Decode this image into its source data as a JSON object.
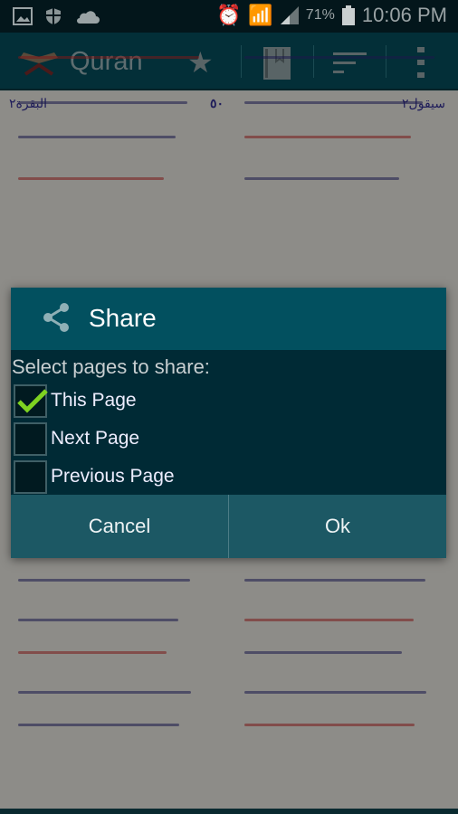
{
  "status_bar": {
    "battery": "71%",
    "time": "10:06 PM",
    "icons": [
      "image-icon",
      "shield-icon",
      "cloud-icon",
      "alarm-icon",
      "wifi-icon",
      "signal-icon",
      "battery-icon"
    ]
  },
  "app_bar": {
    "title": "Quran",
    "icons": [
      "quran-logo-icon",
      "star-icon",
      "bookmark-book-icon",
      "sort-icon",
      "overflow-menu-icon"
    ]
  },
  "page": {
    "page_number": "٥٠",
    "surah": "البقرة٢",
    "juz": "سيقول٢"
  },
  "dialog": {
    "title": "Share",
    "icon": "share-icon",
    "prompt": "Select pages to share:",
    "options": [
      {
        "label": "This Page",
        "checked": true
      },
      {
        "label": "Next Page",
        "checked": false
      },
      {
        "label": "Previous Page",
        "checked": false
      }
    ],
    "cancel": "Cancel",
    "ok": "Ok",
    "check_color": "#7ed321"
  },
  "colors": {
    "dialog_title_bg": "#02505f",
    "dialog_body_bg": "#002a35",
    "dialog_buttons_bg": "#1c5864"
  }
}
